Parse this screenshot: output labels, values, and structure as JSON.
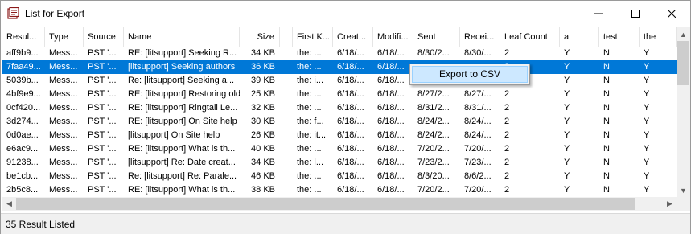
{
  "window": {
    "title": "List for Export"
  },
  "columns": [
    "Resul...",
    "Type",
    "Source",
    "Name",
    "Size",
    "",
    "First K...",
    "Creat...",
    "Modifi...",
    "Sent",
    "Recei...",
    "Leaf Count",
    "a",
    "test",
    "the"
  ],
  "rows": [
    [
      "aff9b9...",
      "Mess...",
      "PST '...",
      "RE: [litsupport] Seeking R...",
      "34 KB",
      "",
      "the:  ...",
      "6/18/...",
      "6/18/...",
      "8/30/2...",
      "8/30/...",
      "2",
      "Y",
      "N",
      "Y"
    ],
    [
      "7faa49...",
      "Mess...",
      "PST '...",
      "[litsupport] Seeking authors",
      "36 KB",
      "",
      "the:  ...",
      "6/18/...",
      "6/18/...",
      "",
      "",
      "2",
      "Y",
      "N",
      "Y"
    ],
    [
      "5039b...",
      "Mess...",
      "PST '...",
      "Re: [litsupport] Seeking a...",
      "39 KB",
      "",
      "the:  i...",
      "6/18/...",
      "6/18/...",
      "",
      "",
      "2",
      "Y",
      "N",
      "Y"
    ],
    [
      "4bf9e9...",
      "Mess...",
      "PST '...",
      "RE: [litsupport] Restoring old f...",
      "25 KB",
      "",
      "the:  ...",
      "6/18/...",
      "6/18/...",
      "8/27/2...",
      "8/27/...",
      "2",
      "Y",
      "N",
      "Y"
    ],
    [
      "0cf420...",
      "Mess...",
      "PST '...",
      "RE: [litsupport] Ringtail Le...",
      "32 KB",
      "",
      "the:  ...",
      "6/18/...",
      "6/18/...",
      "8/31/2...",
      "8/31/...",
      "2",
      "Y",
      "N",
      "Y"
    ],
    [
      "3d274...",
      "Mess...",
      "PST '...",
      "RE: [litsupport] On Site help",
      "30 KB",
      "",
      "the:  f...",
      "6/18/...",
      "6/18/...",
      "8/24/2...",
      "8/24/...",
      "2",
      "Y",
      "N",
      "Y"
    ],
    [
      "0d0ae...",
      "Mess...",
      "PST '...",
      "[litsupport] On Site help",
      "26 KB",
      "",
      "the:  it...",
      "6/18/...",
      "6/18/...",
      "8/24/2...",
      "8/24/...",
      "2",
      "Y",
      "N",
      "Y"
    ],
    [
      "e6ac9...",
      "Mess...",
      "PST '...",
      "RE: [litsupport] What is th...",
      "40 KB",
      "",
      "the:  ...",
      "6/18/...",
      "6/18/...",
      "7/20/2...",
      "7/20/...",
      "2",
      "Y",
      "N",
      "Y"
    ],
    [
      "91238...",
      "Mess...",
      "PST '...",
      "[litsupport] Re: Date creat...",
      "34 KB",
      "",
      "the:  l...",
      "6/18/...",
      "6/18/...",
      "7/23/2...",
      "7/23/...",
      "2",
      "Y",
      "N",
      "Y"
    ],
    [
      "be1cb...",
      "Mess...",
      "PST '...",
      "Re: [litsupport] Re: Parale...",
      "46 KB",
      "",
      "the:  ...",
      "6/18/...",
      "6/18/...",
      "8/3/20...",
      "8/6/2...",
      "2",
      "Y",
      "N",
      "Y"
    ],
    [
      "2b5c8...",
      "Mess...",
      "PST '...",
      "RE: [litsupport] What is th...",
      "38 KB",
      "",
      "the:  ...",
      "6/18/...",
      "6/18/...",
      "7/20/2...",
      "7/20/...",
      "2",
      "Y",
      "N",
      "Y"
    ]
  ],
  "selected_row": 1,
  "context_menu": {
    "item": "Export to CSV"
  },
  "status": {
    "text": "35  Result Listed"
  },
  "colors": {
    "selection": "#0078d7",
    "menu_hover": "#cde8ff"
  }
}
